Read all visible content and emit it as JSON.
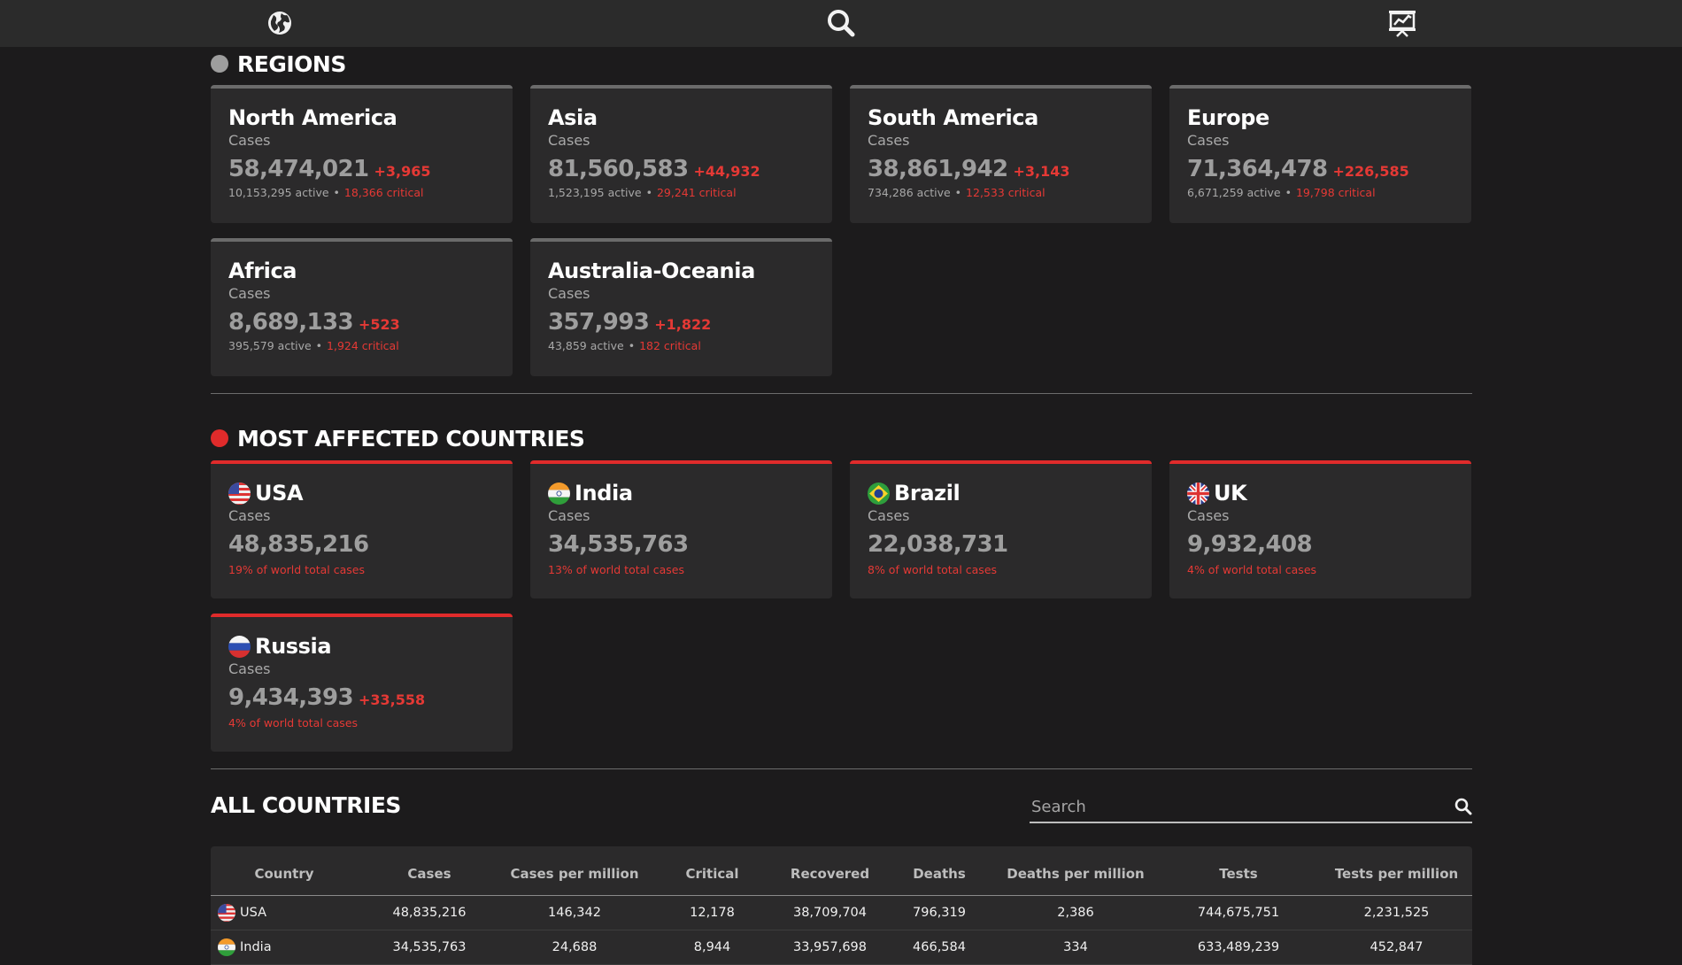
{
  "sections": {
    "regions_title": "REGIONS",
    "most_affected_title": "MOST AFFECTED COUNTRIES",
    "all_countries_title": "ALL COUNTRIES"
  },
  "regions": [
    {
      "name": "North America",
      "label": "Cases",
      "value": "58,474,021",
      "delta": "+3,965",
      "active": "10,153,295 active",
      "critical": "18,366 critical"
    },
    {
      "name": "Asia",
      "label": "Cases",
      "value": "81,560,583",
      "delta": "+44,932",
      "active": "1,523,195 active",
      "critical": "29,241 critical"
    },
    {
      "name": "South America",
      "label": "Cases",
      "value": "38,861,942",
      "delta": "+3,143",
      "active": "734,286 active",
      "critical": "12,533 critical"
    },
    {
      "name": "Europe",
      "label": "Cases",
      "value": "71,364,478",
      "delta": "+226,585",
      "active": "6,671,259 active",
      "critical": "19,798 critical"
    },
    {
      "name": "Africa",
      "label": "Cases",
      "value": "8,689,133",
      "delta": "+523",
      "active": "395,579 active",
      "critical": "1,924 critical"
    },
    {
      "name": "Australia-Oceania",
      "label": "Cases",
      "value": "357,993",
      "delta": "+1,822",
      "active": "43,859 active",
      "critical": "182 critical"
    }
  ],
  "countries": [
    {
      "name": "USA",
      "flag": "us-flag-icon",
      "label": "Cases",
      "value": "48,835,216",
      "delta": "",
      "pct": "19% of world total cases"
    },
    {
      "name": "India",
      "flag": "india-flag-icon",
      "label": "Cases",
      "value": "34,535,763",
      "delta": "",
      "pct": "13% of world total cases"
    },
    {
      "name": "Brazil",
      "flag": "brazil-flag-icon",
      "label": "Cases",
      "value": "22,038,731",
      "delta": "",
      "pct": "8% of world total cases"
    },
    {
      "name": "UK",
      "flag": "uk-flag-icon",
      "label": "Cases",
      "value": "9,932,408",
      "delta": "",
      "pct": "4% of world total cases"
    },
    {
      "name": "Russia",
      "flag": "russia-flag-icon",
      "label": "Cases",
      "value": "9,434,393",
      "delta": "+33,558",
      "pct": "4% of world total cases"
    }
  ],
  "search": {
    "placeholder": "Search"
  },
  "table": {
    "headers": [
      "Country",
      "Cases",
      "Cases per million",
      "Critical",
      "Recovered",
      "Deaths",
      "Deaths per million",
      "Tests",
      "Tests per million"
    ],
    "rows": [
      {
        "country": "USA",
        "flag": "us-flag-icon",
        "cells": [
          "48,835,216",
          "146,342",
          "12,178",
          "38,709,704",
          "796,319",
          "2,386",
          "744,675,751",
          "2,231,525"
        ]
      },
      {
        "country": "India",
        "flag": "india-flag-icon",
        "cells": [
          "34,535,763",
          "24,688",
          "8,944",
          "33,957,698",
          "466,584",
          "334",
          "633,489,239",
          "452,847"
        ]
      }
    ]
  },
  "nav_icons": [
    "globe-icon",
    "search-icon",
    "presentation-chart-icon"
  ],
  "colors": {
    "accent_red": "#e53935",
    "card_bg": "#2b2a2b",
    "page_bg": "#1c1b1c",
    "region_bar": "#6b6b6b",
    "country_bar": "#e02b2b"
  }
}
